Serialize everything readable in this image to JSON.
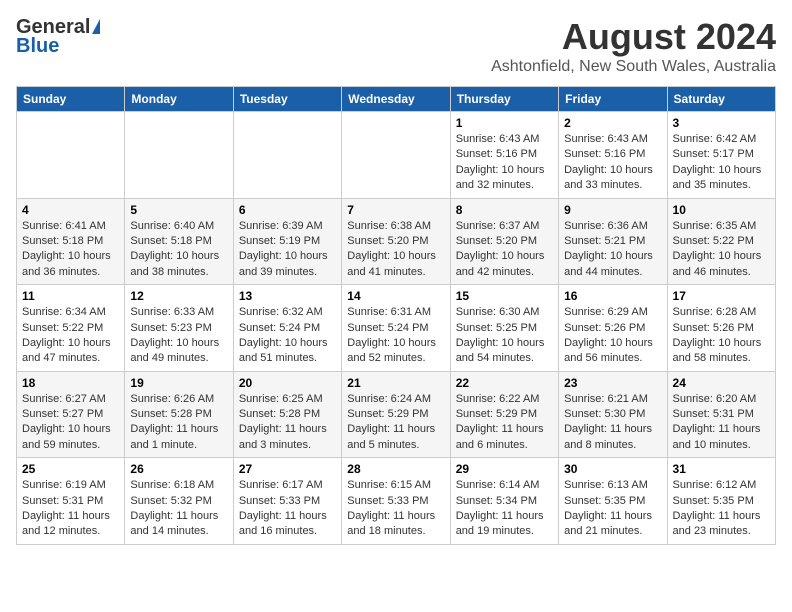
{
  "header": {
    "logo_general": "General",
    "logo_blue": "Blue",
    "main_title": "August 2024",
    "subtitle": "Ashtonfield, New South Wales, Australia"
  },
  "days_of_week": [
    "Sunday",
    "Monday",
    "Tuesday",
    "Wednesday",
    "Thursday",
    "Friday",
    "Saturday"
  ],
  "weeks": [
    [
      {
        "day": "",
        "info": ""
      },
      {
        "day": "",
        "info": ""
      },
      {
        "day": "",
        "info": ""
      },
      {
        "day": "",
        "info": ""
      },
      {
        "day": "1",
        "info": "Sunrise: 6:43 AM\nSunset: 5:16 PM\nDaylight: 10 hours\nand 32 minutes."
      },
      {
        "day": "2",
        "info": "Sunrise: 6:43 AM\nSunset: 5:16 PM\nDaylight: 10 hours\nand 33 minutes."
      },
      {
        "day": "3",
        "info": "Sunrise: 6:42 AM\nSunset: 5:17 PM\nDaylight: 10 hours\nand 35 minutes."
      }
    ],
    [
      {
        "day": "4",
        "info": "Sunrise: 6:41 AM\nSunset: 5:18 PM\nDaylight: 10 hours\nand 36 minutes."
      },
      {
        "day": "5",
        "info": "Sunrise: 6:40 AM\nSunset: 5:18 PM\nDaylight: 10 hours\nand 38 minutes."
      },
      {
        "day": "6",
        "info": "Sunrise: 6:39 AM\nSunset: 5:19 PM\nDaylight: 10 hours\nand 39 minutes."
      },
      {
        "day": "7",
        "info": "Sunrise: 6:38 AM\nSunset: 5:20 PM\nDaylight: 10 hours\nand 41 minutes."
      },
      {
        "day": "8",
        "info": "Sunrise: 6:37 AM\nSunset: 5:20 PM\nDaylight: 10 hours\nand 42 minutes."
      },
      {
        "day": "9",
        "info": "Sunrise: 6:36 AM\nSunset: 5:21 PM\nDaylight: 10 hours\nand 44 minutes."
      },
      {
        "day": "10",
        "info": "Sunrise: 6:35 AM\nSunset: 5:22 PM\nDaylight: 10 hours\nand 46 minutes."
      }
    ],
    [
      {
        "day": "11",
        "info": "Sunrise: 6:34 AM\nSunset: 5:22 PM\nDaylight: 10 hours\nand 47 minutes."
      },
      {
        "day": "12",
        "info": "Sunrise: 6:33 AM\nSunset: 5:23 PM\nDaylight: 10 hours\nand 49 minutes."
      },
      {
        "day": "13",
        "info": "Sunrise: 6:32 AM\nSunset: 5:24 PM\nDaylight: 10 hours\nand 51 minutes."
      },
      {
        "day": "14",
        "info": "Sunrise: 6:31 AM\nSunset: 5:24 PM\nDaylight: 10 hours\nand 52 minutes."
      },
      {
        "day": "15",
        "info": "Sunrise: 6:30 AM\nSunset: 5:25 PM\nDaylight: 10 hours\nand 54 minutes."
      },
      {
        "day": "16",
        "info": "Sunrise: 6:29 AM\nSunset: 5:26 PM\nDaylight: 10 hours\nand 56 minutes."
      },
      {
        "day": "17",
        "info": "Sunrise: 6:28 AM\nSunset: 5:26 PM\nDaylight: 10 hours\nand 58 minutes."
      }
    ],
    [
      {
        "day": "18",
        "info": "Sunrise: 6:27 AM\nSunset: 5:27 PM\nDaylight: 10 hours\nand 59 minutes."
      },
      {
        "day": "19",
        "info": "Sunrise: 6:26 AM\nSunset: 5:28 PM\nDaylight: 11 hours\nand 1 minute."
      },
      {
        "day": "20",
        "info": "Sunrise: 6:25 AM\nSunset: 5:28 PM\nDaylight: 11 hours\nand 3 minutes."
      },
      {
        "day": "21",
        "info": "Sunrise: 6:24 AM\nSunset: 5:29 PM\nDaylight: 11 hours\nand 5 minutes."
      },
      {
        "day": "22",
        "info": "Sunrise: 6:22 AM\nSunset: 5:29 PM\nDaylight: 11 hours\nand 6 minutes."
      },
      {
        "day": "23",
        "info": "Sunrise: 6:21 AM\nSunset: 5:30 PM\nDaylight: 11 hours\nand 8 minutes."
      },
      {
        "day": "24",
        "info": "Sunrise: 6:20 AM\nSunset: 5:31 PM\nDaylight: 11 hours\nand 10 minutes."
      }
    ],
    [
      {
        "day": "25",
        "info": "Sunrise: 6:19 AM\nSunset: 5:31 PM\nDaylight: 11 hours\nand 12 minutes."
      },
      {
        "day": "26",
        "info": "Sunrise: 6:18 AM\nSunset: 5:32 PM\nDaylight: 11 hours\nand 14 minutes."
      },
      {
        "day": "27",
        "info": "Sunrise: 6:17 AM\nSunset: 5:33 PM\nDaylight: 11 hours\nand 16 minutes."
      },
      {
        "day": "28",
        "info": "Sunrise: 6:15 AM\nSunset: 5:33 PM\nDaylight: 11 hours\nand 18 minutes."
      },
      {
        "day": "29",
        "info": "Sunrise: 6:14 AM\nSunset: 5:34 PM\nDaylight: 11 hours\nand 19 minutes."
      },
      {
        "day": "30",
        "info": "Sunrise: 6:13 AM\nSunset: 5:35 PM\nDaylight: 11 hours\nand 21 minutes."
      },
      {
        "day": "31",
        "info": "Sunrise: 6:12 AM\nSunset: 5:35 PM\nDaylight: 11 hours\nand 23 minutes."
      }
    ]
  ]
}
